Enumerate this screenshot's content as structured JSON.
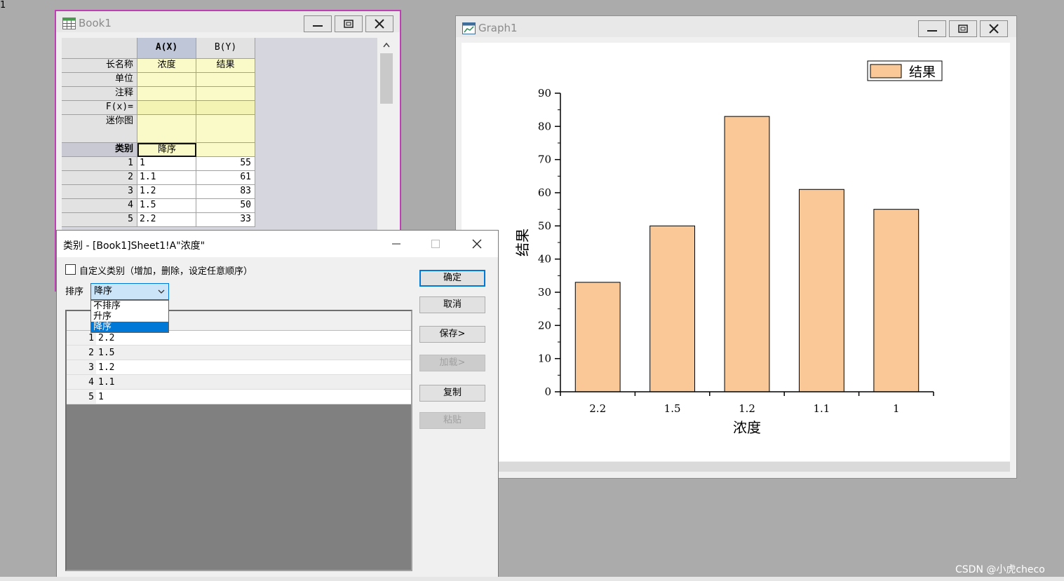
{
  "book1": {
    "title": "Book1",
    "columns": [
      {
        "header": "A(X)",
        "long_name": "浓度",
        "unit": "",
        "comment": "",
        "category": "降序"
      },
      {
        "header": "B(Y)",
        "long_name": "结果",
        "unit": "",
        "comment": "",
        "category": ""
      }
    ],
    "row_labels": {
      "long_name": "长名称",
      "unit": "单位",
      "comment": "注释",
      "formula": "F(x)=",
      "sparkline": "迷你图",
      "category": "类别"
    },
    "rows": [
      {
        "n": "1",
        "a": "1",
        "b": "55"
      },
      {
        "n": "2",
        "a": "1.1",
        "b": "61"
      },
      {
        "n": "3",
        "a": "1.2",
        "b": "83"
      },
      {
        "n": "4",
        "a": "1.5",
        "b": "50"
      },
      {
        "n": "5",
        "a": "2.2",
        "b": "33"
      }
    ]
  },
  "graph1": {
    "title": "Graph1",
    "layer_tab": "1"
  },
  "chart_data": {
    "type": "bar",
    "categories": [
      "2.2",
      "1.5",
      "1.2",
      "1.1",
      "1"
    ],
    "series": [
      {
        "name": "结果",
        "values": [
          33,
          50,
          83,
          61,
          55
        ],
        "color": "#f9c896"
      }
    ],
    "xlabel": "浓度",
    "ylabel": "结果",
    "ylim": [
      0,
      90
    ],
    "yticks": [
      "0",
      "10",
      "20",
      "30",
      "40",
      "50",
      "60",
      "70",
      "80",
      "90"
    ],
    "legend": "top-right",
    "grid": false
  },
  "dialog": {
    "title": "类别 - [Book1]Sheet1!A\"浓度\"",
    "custom_checkbox_label": "自定义类别（增加，删除，设定任意顺序）",
    "sort_label": "排序",
    "sort_selected": "降序",
    "sort_options": [
      "不排序",
      "升序",
      "降序"
    ],
    "list": [
      {
        "n": "1",
        "v": "2.2"
      },
      {
        "n": "2",
        "v": "1.5"
      },
      {
        "n": "3",
        "v": "1.2"
      },
      {
        "n": "4",
        "v": "1.1"
      },
      {
        "n": "5",
        "v": "1"
      }
    ],
    "buttons": {
      "ok": "确定",
      "cancel": "取消",
      "save": "保存>",
      "load": "加载>",
      "copy": "复制",
      "paste": "粘贴"
    }
  },
  "watermark": "CSDN @小虎checo",
  "colors": {
    "accent": "#0078d7",
    "book_border": "#c03fb5",
    "bar_fill": "#f9c896"
  }
}
